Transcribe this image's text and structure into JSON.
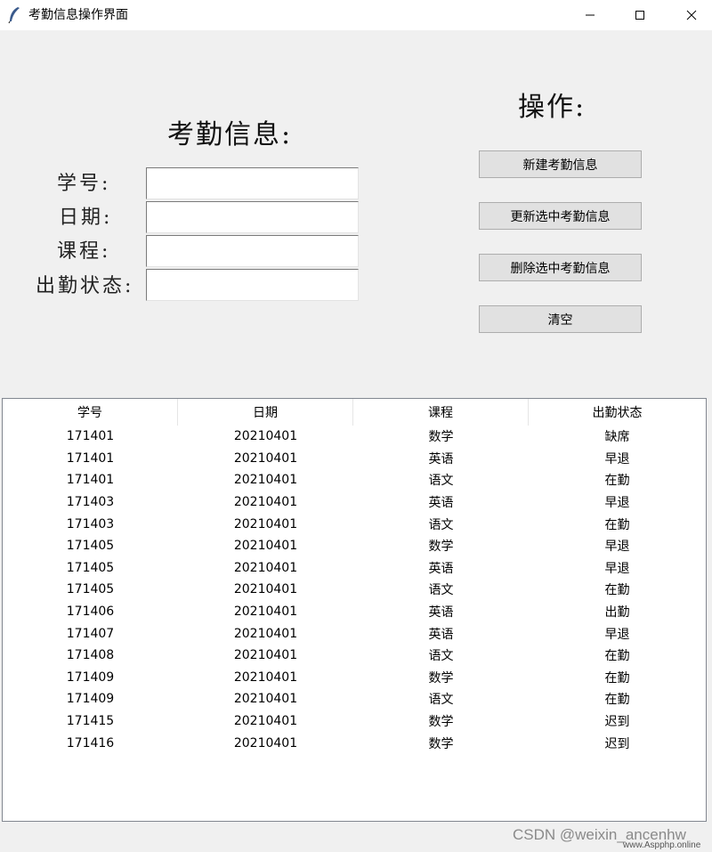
{
  "window": {
    "title": "考勤信息操作界面",
    "icon": "feather-icon"
  },
  "form": {
    "heading": "考勤信息:",
    "fields": [
      {
        "label": "学号:",
        "value": ""
      },
      {
        "label": "日期:",
        "value": ""
      },
      {
        "label": "课程:",
        "value": ""
      },
      {
        "label": "出勤状态:",
        "value": ""
      }
    ]
  },
  "operations": {
    "heading": "操作:",
    "buttons": [
      "新建考勤信息",
      "更新选中考勤信息",
      "删除选中考勤信息",
      "清空"
    ]
  },
  "table": {
    "columns": [
      "学号",
      "日期",
      "课程",
      "出勤状态"
    ],
    "rows": [
      [
        "171401",
        "20210401",
        "数学",
        "缺席"
      ],
      [
        "171401",
        "20210401",
        "英语",
        "早退"
      ],
      [
        "171401",
        "20210401",
        "语文",
        "在勤"
      ],
      [
        "171403",
        "20210401",
        "英语",
        "早退"
      ],
      [
        "171403",
        "20210401",
        "语文",
        "在勤"
      ],
      [
        "171405",
        "20210401",
        "数学",
        "早退"
      ],
      [
        "171405",
        "20210401",
        "英语",
        "早退"
      ],
      [
        "171405",
        "20210401",
        "语文",
        "在勤"
      ],
      [
        "171406",
        "20210401",
        "英语",
        "出勤"
      ],
      [
        "171407",
        "20210401",
        "英语",
        "早退"
      ],
      [
        "171408",
        "20210401",
        "语文",
        "在勤"
      ],
      [
        "171409",
        "20210401",
        "数学",
        "在勤"
      ],
      [
        "171409",
        "20210401",
        "语文",
        "在勤"
      ],
      [
        "171415",
        "20210401",
        "数学",
        "迟到"
      ],
      [
        "171416",
        "20210401",
        "数学",
        "迟到"
      ]
    ]
  },
  "watermark": {
    "text": "CSDN @weixin_ancenhw",
    "site": "www.Aspphp.online"
  }
}
